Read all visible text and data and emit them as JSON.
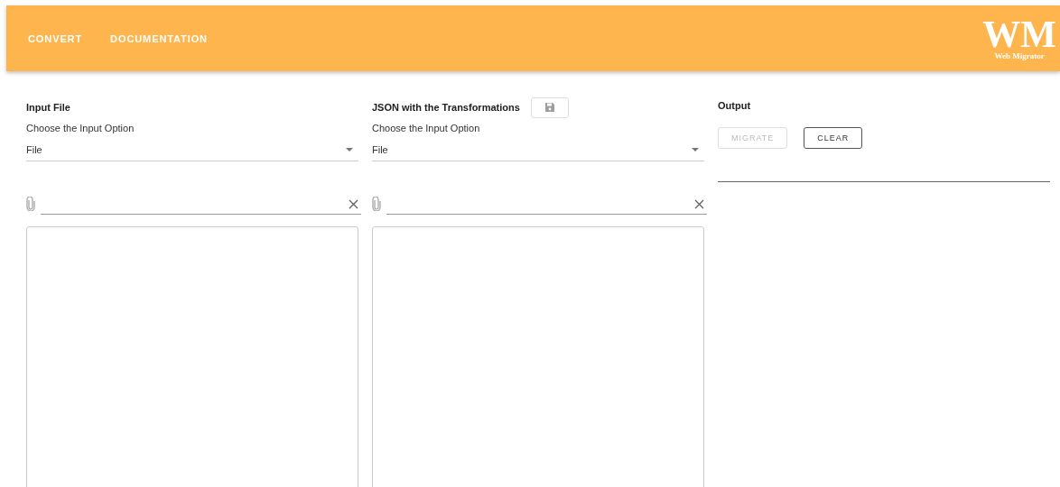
{
  "nav": [
    {
      "label": "CONVERT"
    },
    {
      "label": "DOCUMENTATION"
    }
  ],
  "logo": {
    "mark": "WM",
    "subtitle": "Web Migrator"
  },
  "panels": [
    {
      "title": "Input File",
      "select": {
        "label": "Choose the Input Option",
        "value": "File"
      }
    },
    {
      "title": "JSON with the Transformations",
      "actions": [
        {
          "kind": "save"
        }
      ],
      "select": {
        "label": "Choose the Input Option",
        "value": "File"
      }
    }
  ],
  "output": {
    "title": "Output",
    "buttons": [
      {
        "label": "MIGRATE",
        "disabled": true
      },
      {
        "label": "CLEAR",
        "disabled": false
      }
    ]
  }
}
